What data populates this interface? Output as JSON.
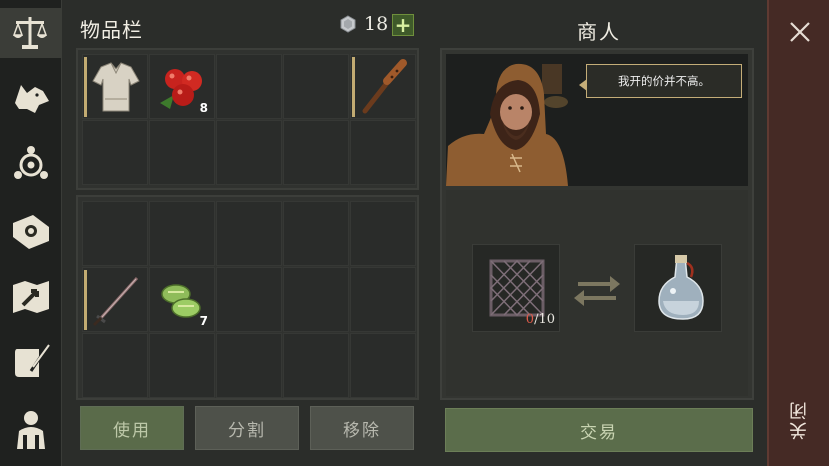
{
  "sidebar": {
    "items": [
      {
        "name": "scales-icon",
        "active": true
      },
      {
        "name": "wolf-icon",
        "active": false
      },
      {
        "name": "compass-icon",
        "active": false
      },
      {
        "name": "skills-book-icon",
        "active": false
      },
      {
        "name": "map-icon",
        "active": false
      },
      {
        "name": "scroll-quill-icon",
        "active": false
      },
      {
        "name": "character-icon",
        "active": false
      }
    ]
  },
  "inventory": {
    "title": "物品栏",
    "currency_icon": "silver-coin-icon",
    "currency_count": "18",
    "add_label": "+",
    "top_grid": [
      {
        "item": "shirt-icon",
        "qty": "",
        "equipped": true
      },
      {
        "item": "apples-icon",
        "qty": "8",
        "equipped": false
      },
      {
        "item": "",
        "qty": "",
        "equipped": false
      },
      {
        "item": "",
        "qty": "",
        "equipped": false
      },
      {
        "item": "club-icon",
        "qty": "",
        "equipped": true
      },
      {
        "item": "",
        "qty": "",
        "equipped": false
      },
      {
        "item": "",
        "qty": "",
        "equipped": false
      },
      {
        "item": "",
        "qty": "",
        "equipped": false
      },
      {
        "item": "",
        "qty": "",
        "equipped": false
      },
      {
        "item": "",
        "qty": "",
        "equipped": false
      }
    ],
    "bottom_grid": [
      {
        "item": "",
        "qty": "",
        "equipped": false
      },
      {
        "item": "",
        "qty": "",
        "equipped": false
      },
      {
        "item": "",
        "qty": "",
        "equipped": false
      },
      {
        "item": "",
        "qty": "",
        "equipped": false
      },
      {
        "item": "",
        "qty": "",
        "equipped": false
      },
      {
        "item": "sword-icon",
        "qty": "",
        "equipped": true
      },
      {
        "item": "slippers-icon",
        "qty": "7",
        "equipped": false
      },
      {
        "item": "",
        "qty": "",
        "equipped": false
      },
      {
        "item": "",
        "qty": "",
        "equipped": false
      },
      {
        "item": "",
        "qty": "",
        "equipped": false
      },
      {
        "item": "",
        "qty": "",
        "equipped": false
      },
      {
        "item": "",
        "qty": "",
        "equipped": false
      },
      {
        "item": "",
        "qty": "",
        "equipped": false
      },
      {
        "item": "",
        "qty": "",
        "equipped": false
      },
      {
        "item": "",
        "qty": "",
        "equipped": false
      }
    ],
    "buttons": {
      "use": "使用",
      "split": "分割",
      "remove": "移除"
    }
  },
  "merchant": {
    "title": "商人",
    "speech": "我开的价并不高。",
    "give_item": "lattice-frame-icon",
    "give_have": "0",
    "give_need": "/10",
    "receive_item": "potion-bottle-icon",
    "swap_icon": "swap-arrows-icon",
    "trade_label": "交易"
  },
  "close": {
    "icon": "close-icon",
    "label": "关闭"
  },
  "colors": {
    "accent_gold": "#c2ab72",
    "button_green": "#5b6d4b",
    "close_rail": "#452a25",
    "shortage_red": "#e05b4a"
  }
}
